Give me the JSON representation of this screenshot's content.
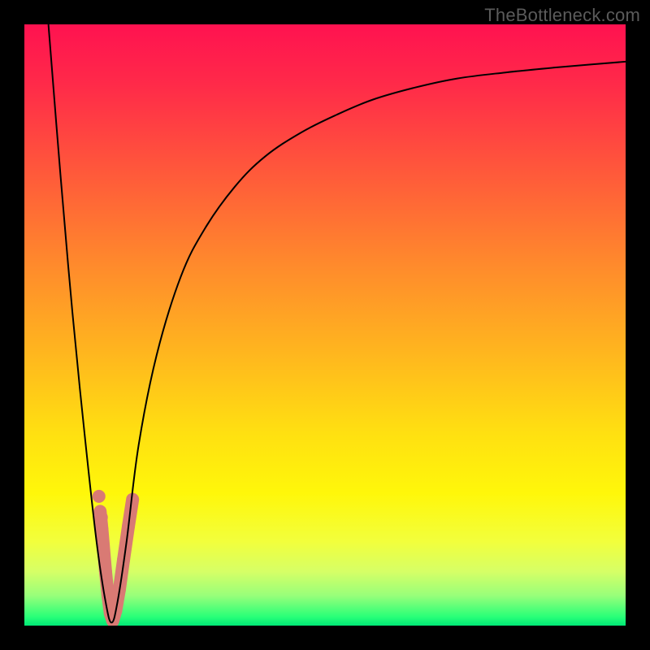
{
  "watermark": "TheBottleneck.com",
  "colors": {
    "frame": "#000000",
    "curve": "#000000",
    "marker": "#d97a74",
    "gradient_stops": [
      {
        "offset": 0.0,
        "color": "#ff1250"
      },
      {
        "offset": 0.1,
        "color": "#ff2a49"
      },
      {
        "offset": 0.25,
        "color": "#ff5a3a"
      },
      {
        "offset": 0.4,
        "color": "#ff8a2c"
      },
      {
        "offset": 0.55,
        "color": "#ffb71e"
      },
      {
        "offset": 0.68,
        "color": "#ffe011"
      },
      {
        "offset": 0.78,
        "color": "#fff70a"
      },
      {
        "offset": 0.86,
        "color": "#f2ff3c"
      },
      {
        "offset": 0.91,
        "color": "#d6ff66"
      },
      {
        "offset": 0.95,
        "color": "#98ff7a"
      },
      {
        "offset": 0.985,
        "color": "#2aff78"
      },
      {
        "offset": 1.0,
        "color": "#00e876"
      }
    ]
  },
  "chart_data": {
    "type": "line",
    "title": "",
    "xlabel": "",
    "ylabel": "",
    "xlim": [
      0,
      100
    ],
    "ylim": [
      0,
      100
    ],
    "grid": false,
    "legend": false,
    "series": [
      {
        "name": "bottleneck-curve",
        "x": [
          4,
          6,
          8,
          10,
          12,
          13.5,
          14.5,
          15.5,
          17,
          19,
          22,
          26,
          30,
          35,
          40,
          46,
          52,
          58,
          65,
          72,
          80,
          88,
          95,
          100
        ],
        "y": [
          100,
          75,
          52,
          32,
          14,
          4,
          0.5,
          4,
          14,
          30,
          45,
          58,
          66,
          73,
          78,
          82,
          85,
          87.5,
          89.5,
          91,
          92,
          92.8,
          93.4,
          93.8
        ]
      }
    ],
    "annotations": {
      "minimum_x": 14.5,
      "marker_cluster": {
        "description": "rounded marker strokes near curve minimum",
        "points": [
          {
            "x": 12.6,
            "y": 19.0
          },
          {
            "x": 12.9,
            "y": 16.0
          },
          {
            "x": 13.5,
            "y": 9.0
          },
          {
            "x": 13.9,
            "y": 5.0
          },
          {
            "x": 14.3,
            "y": 2.0
          },
          {
            "x": 14.7,
            "y": 0.8
          },
          {
            "x": 15.2,
            "y": 2.5
          },
          {
            "x": 15.8,
            "y": 6.0
          },
          {
            "x": 16.5,
            "y": 11.0
          },
          {
            "x": 17.3,
            "y": 16.5
          },
          {
            "x": 18.0,
            "y": 21.0
          }
        ]
      }
    }
  }
}
